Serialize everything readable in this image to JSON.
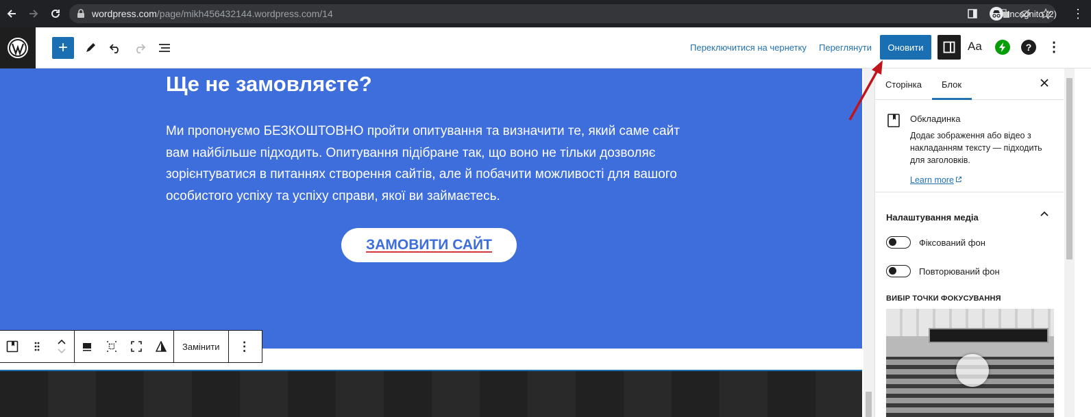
{
  "browser": {
    "url_host": "wordpress.com",
    "url_path": "/page/mikh456432144.wordpress.com/14",
    "profile_label": "Incognito (2)"
  },
  "header": {
    "switch_draft_label": "Переключитися на чернетку",
    "preview_label": "Переглянути",
    "update_label": "Оновити",
    "styles_label": "Aa"
  },
  "content": {
    "heading": "Ще не замовляєте?",
    "paragraph": "Ми пропонуємо БЕЗКОШТОВНО пройти опитування та визначити те, який саме сайт вам найбільше підходить. Опитування підібране так, що воно не тільки дозволяє зорієнтуватися в питаннях створення сайтів, але й побачити можливості для вашого особистого успіху та успіху справи, якої ви займаєтесь.",
    "cta_label": "ЗАМОВИТИ САЙТ"
  },
  "block_toolbar": {
    "replace_label": "Замінити"
  },
  "sidebar": {
    "tab_page": "Сторінка",
    "tab_block": "Блок",
    "block_title": "Обкладинка",
    "block_description": "Додає зображення або відео з накладанням тексту — підходить для заголовків.",
    "learn_more": "Learn more",
    "media_panel_title": "Налаштування медіа",
    "toggle_fixed_bg": "Фіксований фон",
    "toggle_repeat_bg": "Повторюваний фон",
    "focal_point_label": "ВИБІР ТОЧКИ ФОКУСУВАННЯ"
  },
  "colors": {
    "cover_blue": "#3e6ddc",
    "wp_blue": "#1a6fb3",
    "annotation_red": "#c0141b"
  }
}
